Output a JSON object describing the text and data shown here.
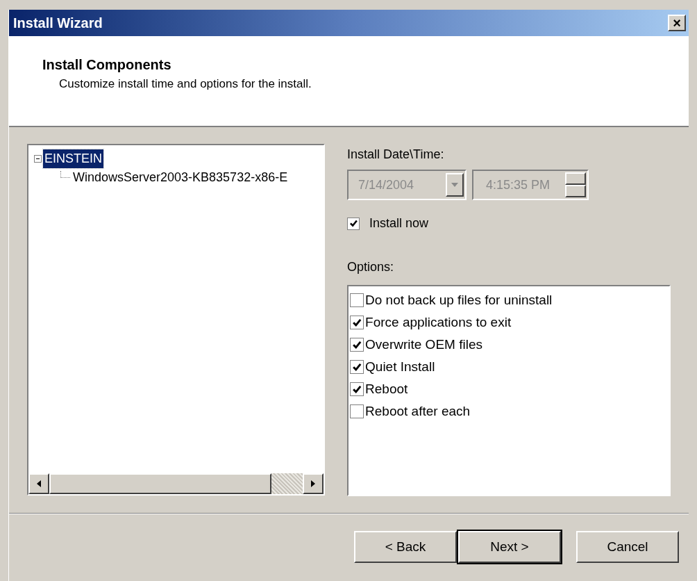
{
  "window": {
    "title": "Install Wizard",
    "close": "×"
  },
  "header": {
    "title": "Install Components",
    "subtitle": "Customize install time and options for the install."
  },
  "tree": [
    {
      "label": "EINSTEIN",
      "selected": true,
      "expanded": true,
      "children": [
        {
          "label": "WindowsServer2003-KB835732-x86-E",
          "selected": false
        }
      ]
    }
  ],
  "schedule": {
    "label": "Install Date\\Time:",
    "date": {
      "value": "7/14/2004",
      "disabled": true
    },
    "time": {
      "value": "4:15:35 PM",
      "disabled": true
    },
    "install_now": {
      "label": "Install now",
      "checked": true
    }
  },
  "options": {
    "label": "Options:",
    "items": [
      {
        "label": "Do not back up files for uninstall",
        "checked": false
      },
      {
        "label": "Force applications to exit",
        "checked": true
      },
      {
        "label": "Overwrite OEM files",
        "checked": true
      },
      {
        "label": "Quiet Install",
        "checked": true
      },
      {
        "label": "Reboot",
        "checked": true
      },
      {
        "label": "Reboot after each",
        "checked": false
      }
    ]
  },
  "buttons": [
    {
      "label": "< Back",
      "default": false
    },
    {
      "label": "Next >",
      "default": true
    },
    {
      "label": "Cancel",
      "default": false
    }
  ]
}
